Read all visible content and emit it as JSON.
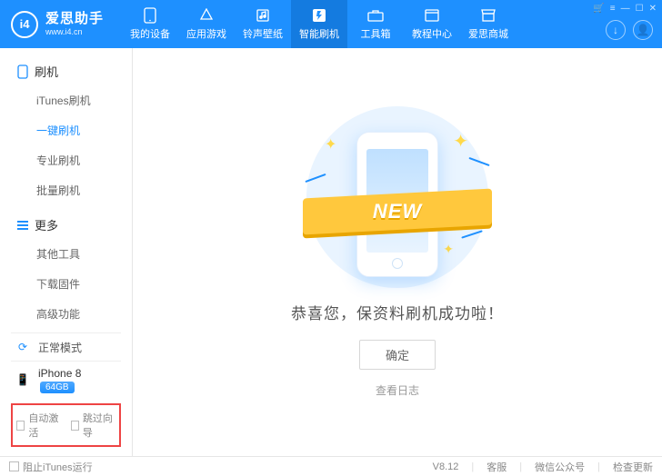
{
  "app": {
    "name": "爱思助手",
    "url": "www.i4.cn",
    "logo_mark": "i4"
  },
  "nav": {
    "items": [
      {
        "label": "我的设备",
        "icon": "phone"
      },
      {
        "label": "应用游戏",
        "icon": "apps"
      },
      {
        "label": "铃声壁纸",
        "icon": "music"
      },
      {
        "label": "智能刷机",
        "icon": "flash",
        "active": true
      },
      {
        "label": "工具箱",
        "icon": "toolbox"
      },
      {
        "label": "教程中心",
        "icon": "book"
      },
      {
        "label": "爱思商城",
        "icon": "store"
      }
    ]
  },
  "window_controls": {
    "cart": "🛒",
    "settings": "≡",
    "minimize": "—",
    "maximize": "☐",
    "close": "✕"
  },
  "header_circles": {
    "download": "↓",
    "account": "👤"
  },
  "sidebar": {
    "groups": [
      {
        "title": "刷机",
        "icon": "flash",
        "items": [
          {
            "label": "iTunes刷机"
          },
          {
            "label": "一键刷机",
            "active": true
          },
          {
            "label": "专业刷机"
          },
          {
            "label": "批量刷机"
          }
        ]
      },
      {
        "title": "更多",
        "icon": "more",
        "items": [
          {
            "label": "其他工具"
          },
          {
            "label": "下载固件"
          },
          {
            "label": "高级功能"
          }
        ]
      }
    ],
    "mode": {
      "label": "正常模式",
      "icon": "sync"
    },
    "device": {
      "name": "iPhone 8",
      "storage": "64GB"
    },
    "options": {
      "auto_activate": "自动激活",
      "skip_guide": "跳过向导"
    }
  },
  "main": {
    "ribbon_text": "NEW",
    "success_text": "恭喜您，保资料刷机成功啦！",
    "ok_label": "确定",
    "log_label": "查看日志"
  },
  "statusbar": {
    "block_itunes": "阻止iTunes运行",
    "version": "V8.12",
    "links": [
      "客服",
      "微信公众号",
      "检查更新"
    ]
  }
}
